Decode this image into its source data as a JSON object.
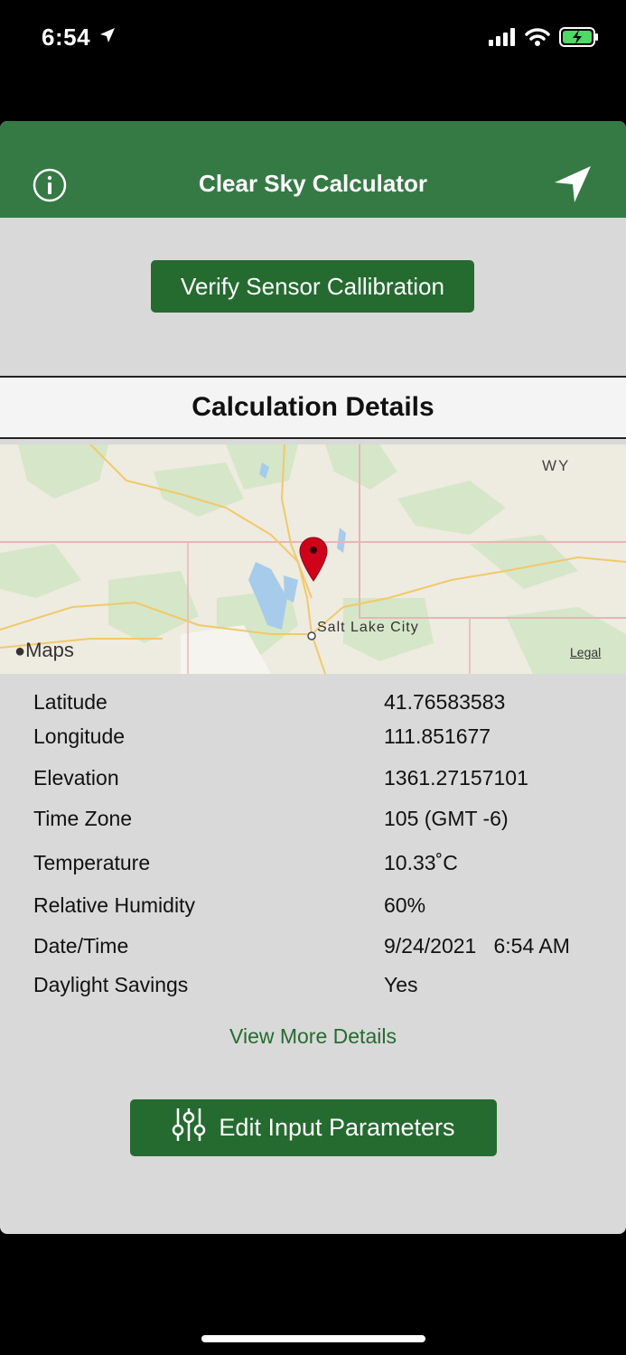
{
  "status_bar": {
    "time": "6:54"
  },
  "app": {
    "title": "Clear Sky Calculator"
  },
  "verify_button": {
    "label": "Verify Sensor Callibration"
  },
  "section": {
    "title": "Calculation Details"
  },
  "map": {
    "state_label": "WY",
    "city_label": "Salt Lake City",
    "logo_text": "Maps",
    "legal_text": "Legal"
  },
  "details": [
    {
      "label": "Latitude",
      "value": "41.76583583"
    },
    {
      "label": "Longitude",
      "value": "111.851677"
    },
    {
      "label": "Elevation",
      "value": "1361.27157101"
    },
    {
      "label": "Time Zone",
      "value": "105 (GMT -6)"
    },
    {
      "label": "Temperature",
      "value": "10.33˚C"
    },
    {
      "label": "Relative Humidity",
      "value": "60%"
    },
    {
      "label": "Date/Time",
      "value": "9/24/2021   6:54 AM"
    },
    {
      "label": "Daylight Savings",
      "value": "Yes"
    }
  ],
  "more_link": {
    "label": "View More Details"
  },
  "edit_button": {
    "label": "Edit Input Parameters"
  },
  "colors": {
    "nav_green": "#357a45",
    "button_green": "#256b30",
    "pin_red": "#d0021b"
  }
}
